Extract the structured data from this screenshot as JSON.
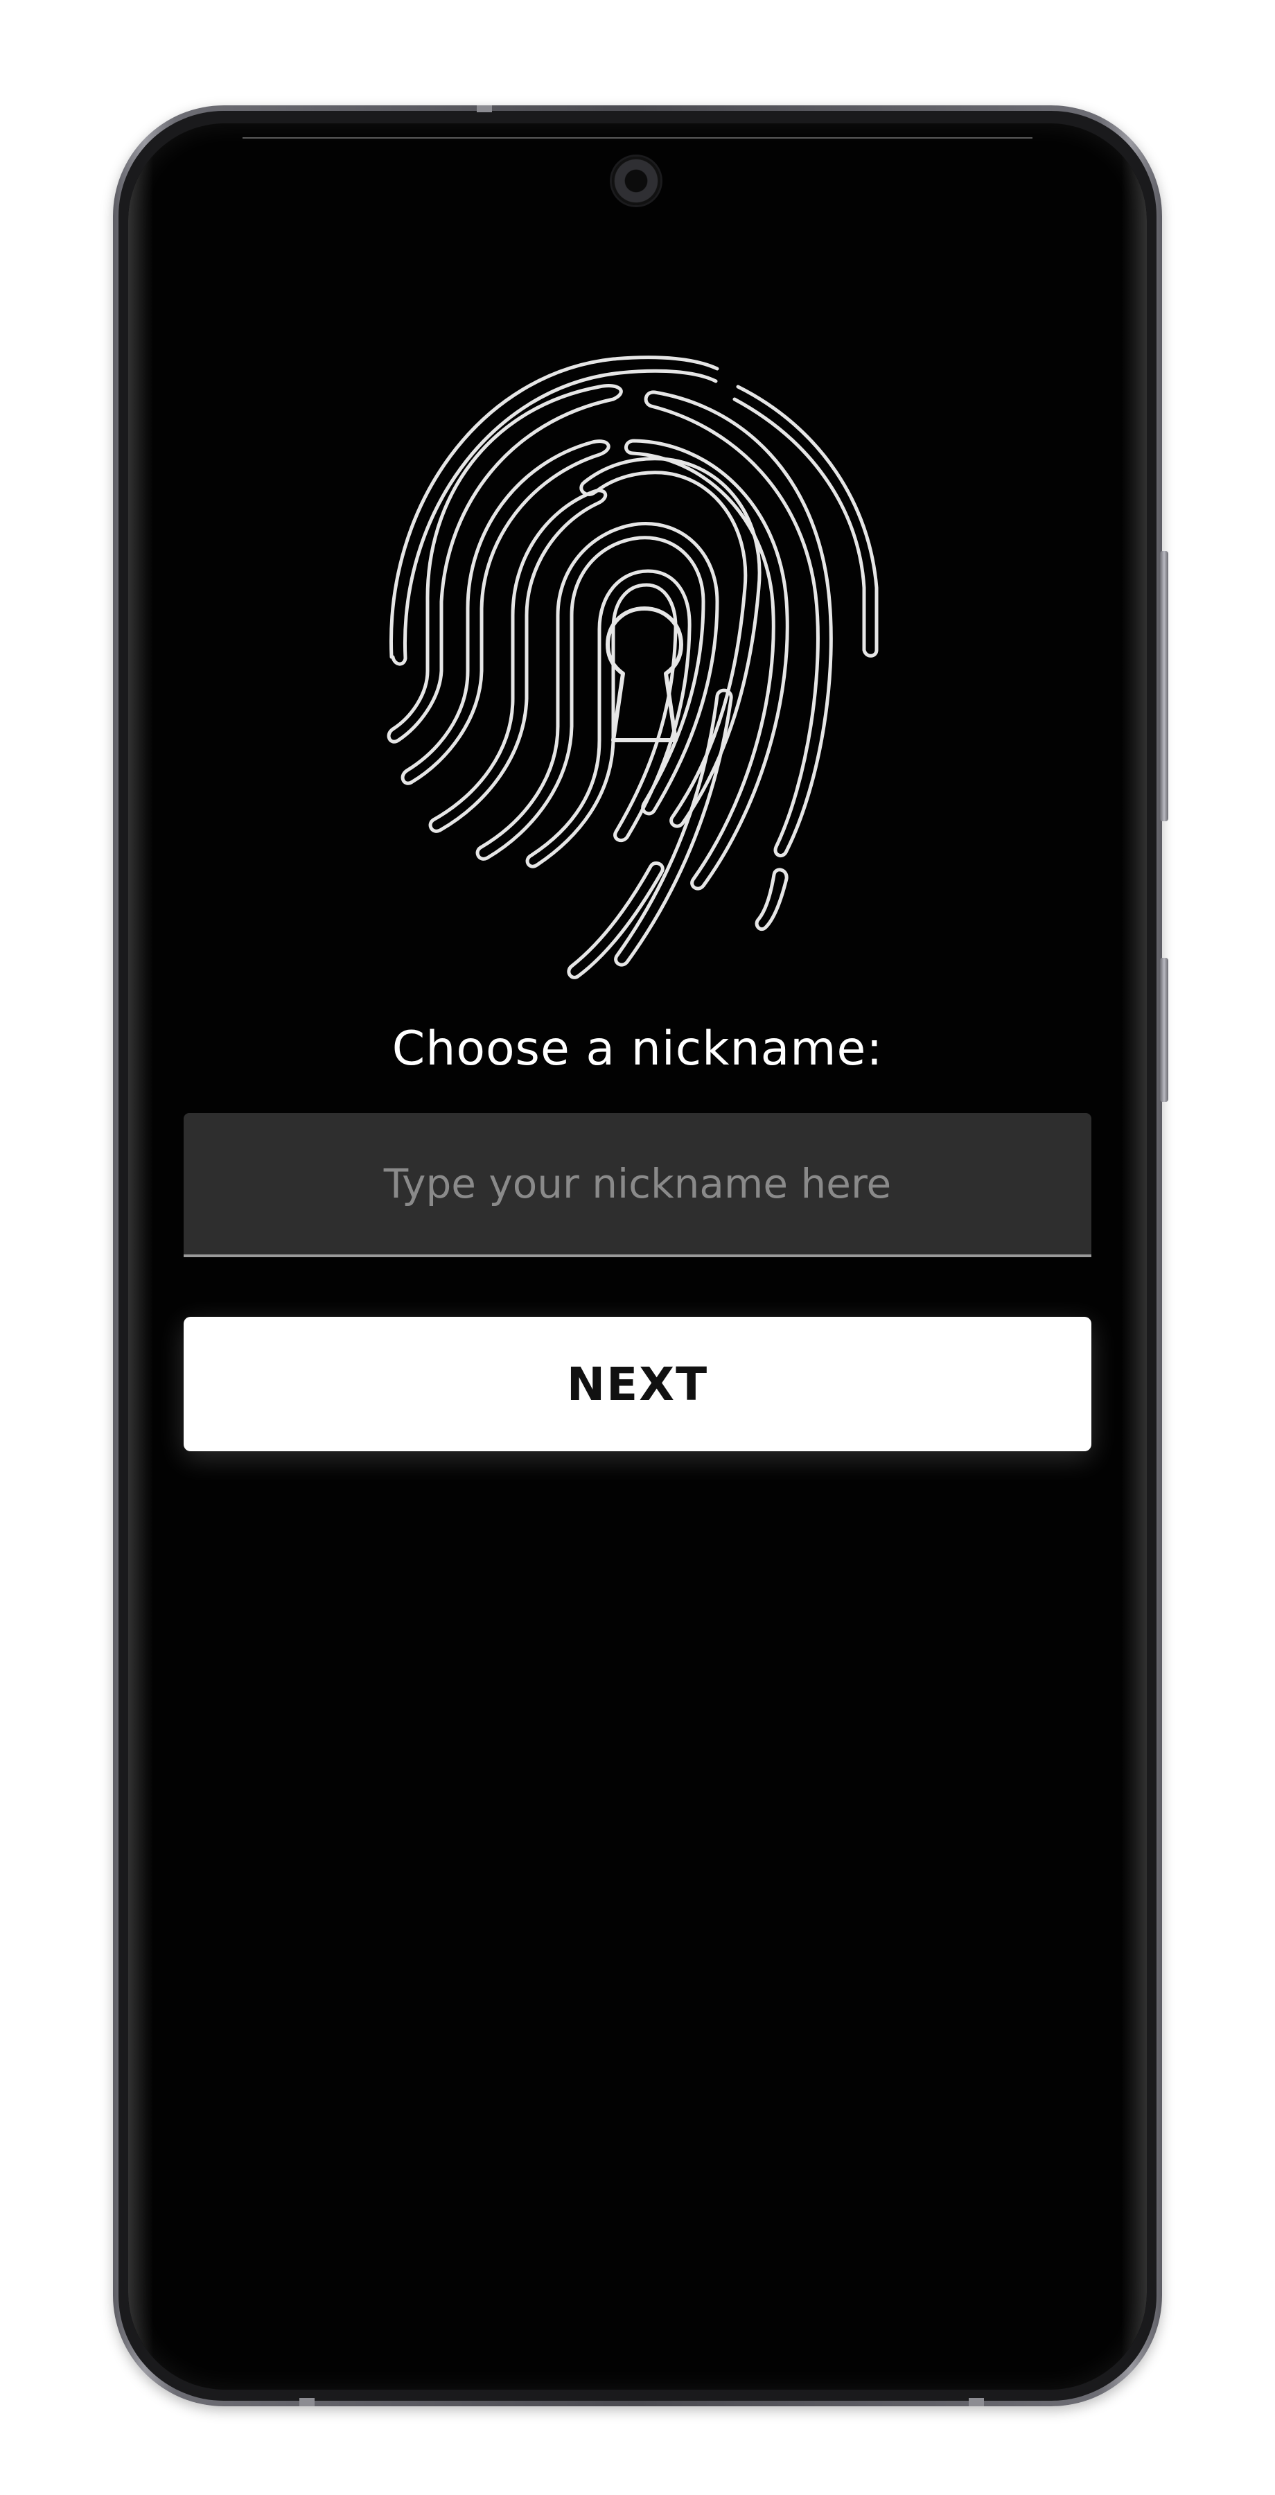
{
  "screen": {
    "background": "#020202",
    "icon": "fingerprint-keyhole-icon"
  },
  "nickname": {
    "label": "Choose a nickname:",
    "value": "",
    "placeholder": "Type your nickname here"
  },
  "actions": {
    "next_label": "NEXT"
  }
}
